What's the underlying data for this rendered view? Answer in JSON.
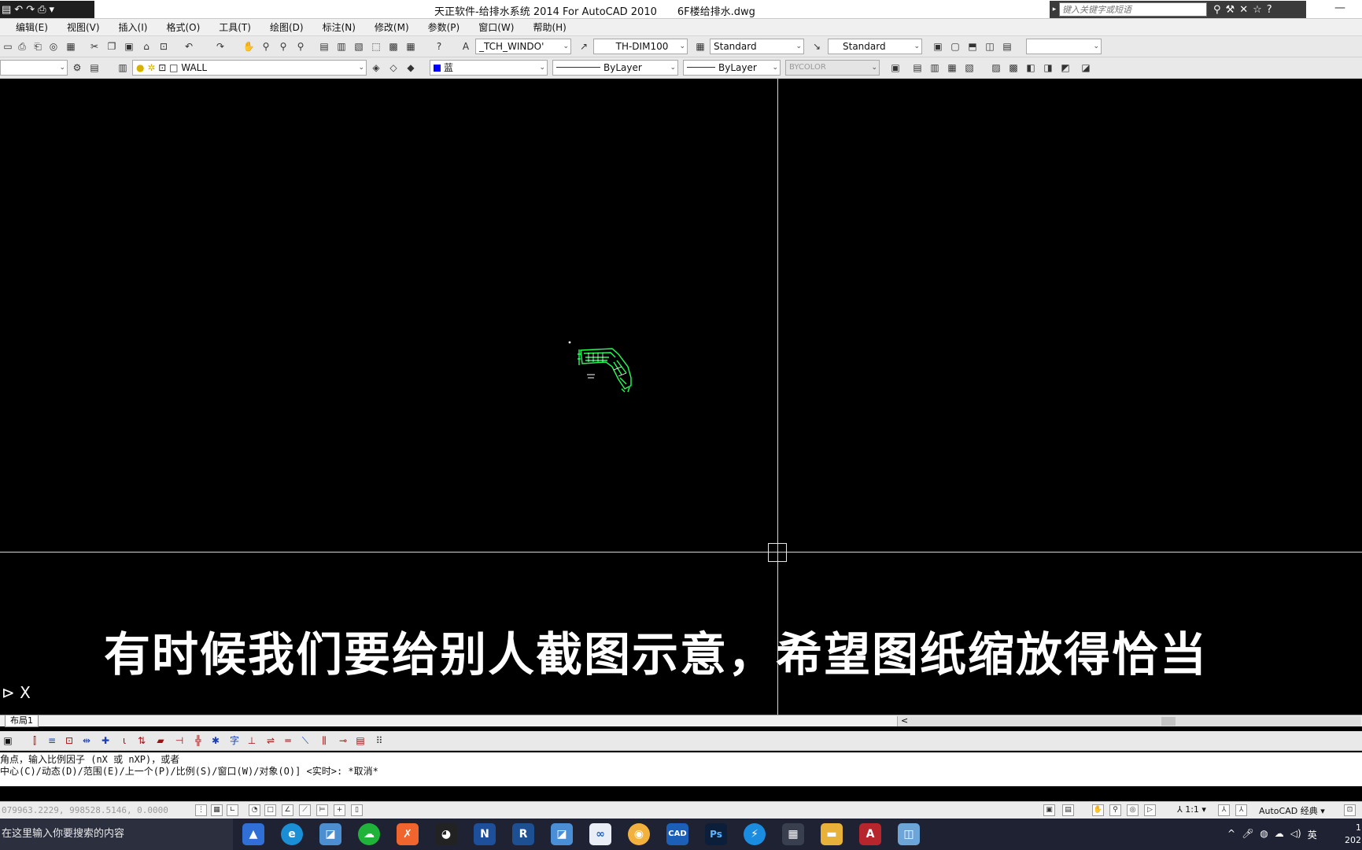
{
  "window": {
    "title": "天正软件-给排水系统 2014 For AutoCAD 2010　　6F楼给排水.dwg",
    "search_placeholder": "键入关键字或短语",
    "minimize": "—"
  },
  "qat": [
    "▤",
    "↶",
    "↷",
    "⎙",
    "▾"
  ],
  "menu": [
    "编辑(E)",
    "视图(V)",
    "插入(I)",
    "格式(O)",
    "工具(T)",
    "绘图(D)",
    "标注(N)",
    "修改(M)",
    "参数(P)",
    "窗口(W)",
    "帮助(H)"
  ],
  "toolbar1": {
    "text_style": "_TCH_WINDO'",
    "dim_style": "TH-DIM100",
    "table_style": "Standard",
    "multileader_style": "Standard",
    "blank_combo": ""
  },
  "toolbar2": {
    "layer_left": "",
    "layer": "WALL",
    "color": "蓝",
    "color_hex": "#0000ff",
    "linetype": "ByLayer",
    "lineweight": "ByLayer",
    "plotstyle": "BYCOLOR"
  },
  "canvas": {
    "background": "#000000",
    "plan_color": "#22ff55",
    "subtitle": "有时候我们要给别人截图示意，希望图纸缩放得恰当",
    "ucs": "⊳ X"
  },
  "tabs": {
    "layout": "布局1",
    "scroll_left": "<"
  },
  "command": {
    "line1": "角点，输入比例因子 (nX 或 nXP)，或者",
    "line2": "中心(C)/动态(D)/范围(E)/上一个(P)/比例(S)/窗口(W)/对象(O)] <实时>: *取消*"
  },
  "status": {
    "coords": "079963.2229, 998528.5146, 0.0000",
    "scale": "⅄ 1:1 ▾",
    "workspace": "AutoCAD 经典 ▾"
  },
  "taskbar": {
    "search_text": "在这里输入你要搜索的内容",
    "tray_lang": "英",
    "clock_time": "1",
    "clock_date": "202"
  }
}
